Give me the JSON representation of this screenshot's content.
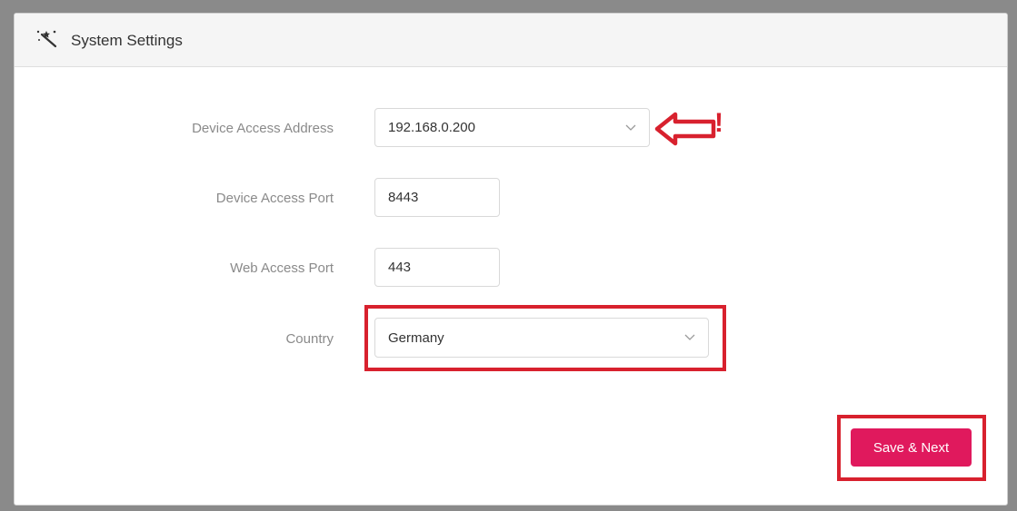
{
  "header": {
    "title": "System Settings",
    "icon": "magic-wand-icon"
  },
  "form": {
    "device_access_address": {
      "label": "Device Access Address",
      "value": "192.168.0.200"
    },
    "device_access_port": {
      "label": "Device Access Port",
      "value": "8443"
    },
    "web_access_port": {
      "label": "Web Access Port",
      "value": "443"
    },
    "country": {
      "label": "Country",
      "value": "Germany"
    }
  },
  "actions": {
    "save_next_label": "Save & Next"
  },
  "annotations": {
    "exclamation": "!",
    "highlight_color": "#d8212e"
  },
  "colors": {
    "primary_button": "#e0195d",
    "label_text": "#8a8a8a"
  }
}
